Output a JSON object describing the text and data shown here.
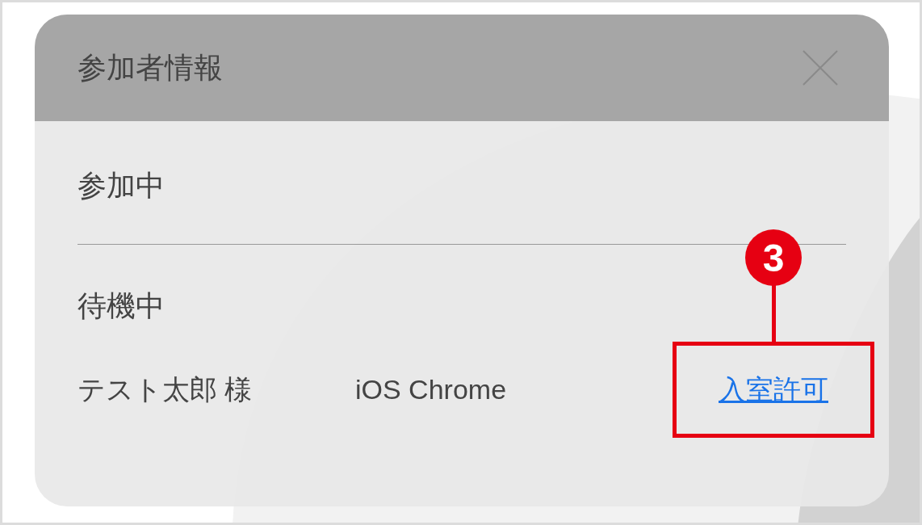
{
  "dialog": {
    "title": "参加者情報",
    "sections": [
      {
        "heading": "参加中"
      },
      {
        "heading": "待機中",
        "participants": [
          {
            "name": "テスト太郎 様",
            "device": "iOS Chrome",
            "action": "入室許可"
          }
        ]
      }
    ]
  },
  "callout": {
    "number": "3"
  }
}
